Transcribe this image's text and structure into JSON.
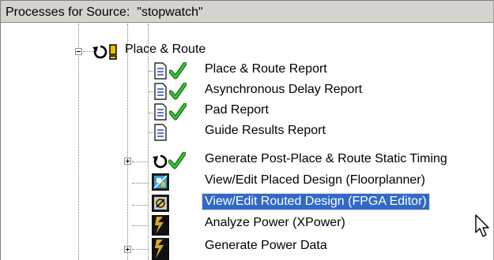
{
  "panel": {
    "header_label": "Processes for Source:",
    "header_source": "\"stopwatch\""
  },
  "tree": {
    "items": [
      {
        "label": "Place & Route"
      },
      {
        "label": "Place & Route Report"
      },
      {
        "label": "Asynchronous Delay Report"
      },
      {
        "label": "Pad Report"
      },
      {
        "label": "Guide Results Report"
      },
      {
        "label": "Generate Post-Place & Route Static Timing"
      },
      {
        "label": "View/Edit Placed Design (Floorplanner)"
      },
      {
        "label": "View/Edit Routed Design (FPGA Editor)"
      },
      {
        "label": "Analyze Power (XPower)"
      },
      {
        "label": "Generate Power Data"
      }
    ]
  },
  "colors": {
    "selection": "#316ac5",
    "check": "#1e9e1e",
    "warning": "#e6c000"
  }
}
